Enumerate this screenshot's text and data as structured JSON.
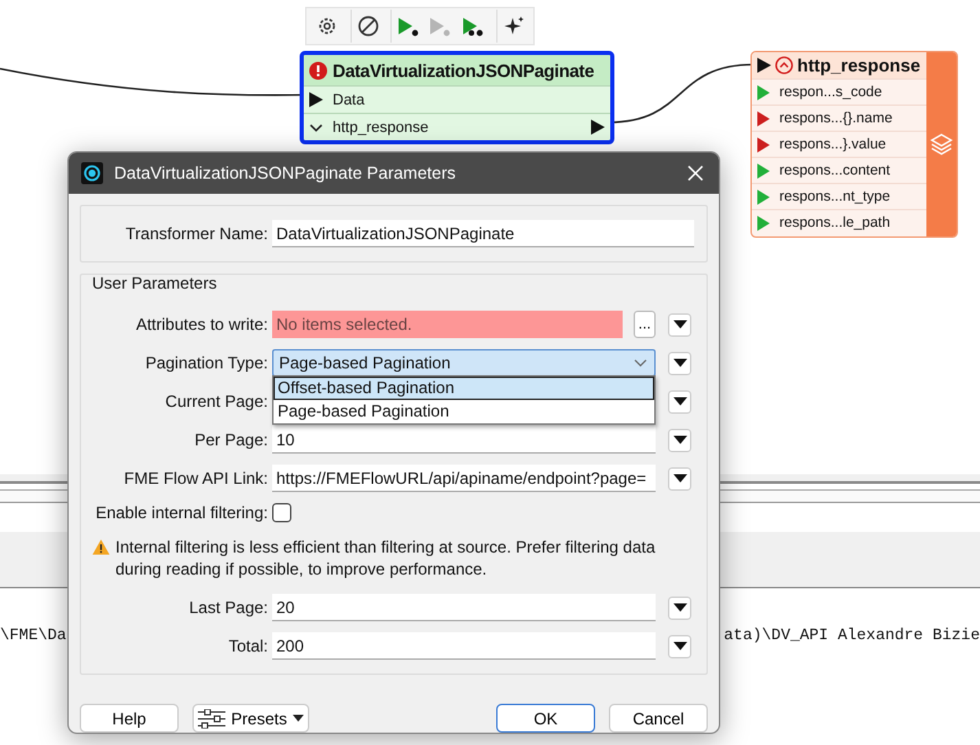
{
  "toolbar": [
    {
      "kind": "settings"
    },
    {
      "kind": "disable"
    },
    {
      "kind": "run",
      "disabled": false
    },
    {
      "kind": "run",
      "disabled": true
    },
    {
      "kind": "run_from",
      "disabled": false
    },
    {
      "kind": "magic"
    }
  ],
  "transformer": {
    "title": "DataVirtualizationJSONPaginate",
    "error": true,
    "selected": true,
    "inputs": [
      {
        "label": "Data"
      }
    ],
    "outputs": [
      {
        "label": "http_response"
      }
    ]
  },
  "output_node": {
    "title": "http_response",
    "attributes": [
      {
        "label": "respon...s_code",
        "color": "#22b03a"
      },
      {
        "label": "respons...{}.name",
        "color": "#cc1f1f"
      },
      {
        "label": "respons...}.value",
        "color": "#cc1f1f"
      },
      {
        "label": "respons...content",
        "color": "#22b03a"
      },
      {
        "label": "respons...nt_type",
        "color": "#22b03a"
      },
      {
        "label": "respons...le_path",
        "color": "#22b03a"
      }
    ]
  },
  "log": {
    "left": "\\FME\\Da",
    "right": "ata)\\DV_API Alexandre Bizie"
  },
  "dialog": {
    "title": "DataVirtualizationJSONPaginate Parameters",
    "transformer_name": {
      "label": "Transformer Name:",
      "value": "DataVirtualizationJSONPaginate"
    },
    "group_title": "User Parameters",
    "params": [
      {
        "kind": "list",
        "label": "Attributes to write:",
        "placeholder": "No items selected.",
        "error": true,
        "button": "..."
      },
      {
        "kind": "dropdown",
        "label": "Pagination Type:",
        "value": "Page-based Pagination",
        "open": true,
        "options": [
          {
            "label": "Offset-based Pagination",
            "highlighted": true
          },
          {
            "label": "Page-based Pagination",
            "highlighted": false
          }
        ]
      },
      {
        "kind": "text",
        "label": "Current Page:"
      },
      {
        "kind": "text",
        "label": "Per Page:",
        "value": "10"
      },
      {
        "kind": "text",
        "label": "FME Flow API Link:",
        "value": "https://FMEFlowURL/api/apiname/endpoint?page="
      },
      {
        "kind": "checkbox",
        "label": "Enable internal filtering:",
        "checked": false
      },
      {
        "kind": "note",
        "text": "Internal filtering is less efficient than filtering at source. Prefer filtering data during reading if possible, to improve performance."
      },
      {
        "kind": "text",
        "label": "Last Page:",
        "value": "20"
      },
      {
        "kind": "text",
        "label": "Total:",
        "value": "200"
      }
    ],
    "buttons": [
      {
        "label": "Help",
        "kind": "plain"
      },
      {
        "label": "Presets",
        "kind": "menu"
      },
      {
        "label": "OK",
        "kind": "default"
      },
      {
        "label": "Cancel",
        "kind": "plain"
      }
    ]
  }
}
